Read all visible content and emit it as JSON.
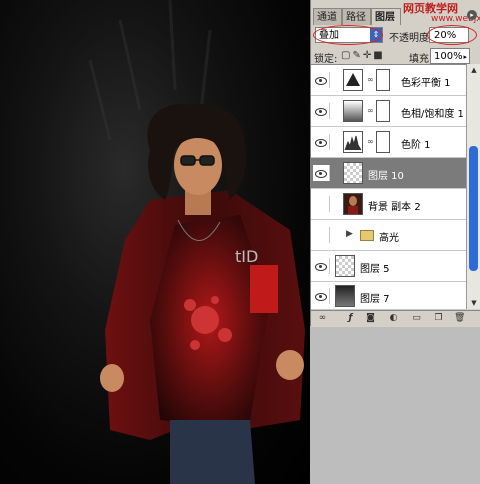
{
  "panel": {
    "tabs": [
      "通道",
      "路径",
      "图层"
    ],
    "active_tab": "图层",
    "watermark": "网页教学网",
    "watermark_url": "www.webjx.com",
    "blend_mode": "叠加",
    "opacity_label": "不透明度:",
    "opacity_value": "20%",
    "lock_label": "锁定:",
    "fill_label": "填充:",
    "fill_value": "100%",
    "accent_color": "#2e6bd6",
    "selected_row_color": "#7b7b7b"
  },
  "layers": [
    {
      "name": "色彩平衡 1",
      "type": "adjustment",
      "icon": "color-balance-icon",
      "visible": true
    },
    {
      "name": "色相/饱和度 1",
      "type": "adjustment",
      "icon": "hue-saturation-icon",
      "visible": true
    },
    {
      "name": "色阶 1",
      "type": "adjustment",
      "icon": "levels-icon",
      "visible": true
    },
    {
      "name": "图层 10",
      "type": "pixel",
      "visible": true,
      "selected": true
    },
    {
      "name": "背景 副本 2",
      "type": "pixel",
      "visible": false
    },
    {
      "name": "高光",
      "type": "group",
      "visible": false
    },
    {
      "name": "图层 5",
      "type": "pixel",
      "visible": true
    },
    {
      "name": "图层 7",
      "type": "pixel",
      "visible": true
    }
  ],
  "bottom_icons": [
    "link-layers-icon",
    "layer-style-icon",
    "add-mask-icon",
    "adjustment-layer-icon",
    "new-group-icon",
    "new-layer-icon",
    "delete-layer-icon"
  ]
}
